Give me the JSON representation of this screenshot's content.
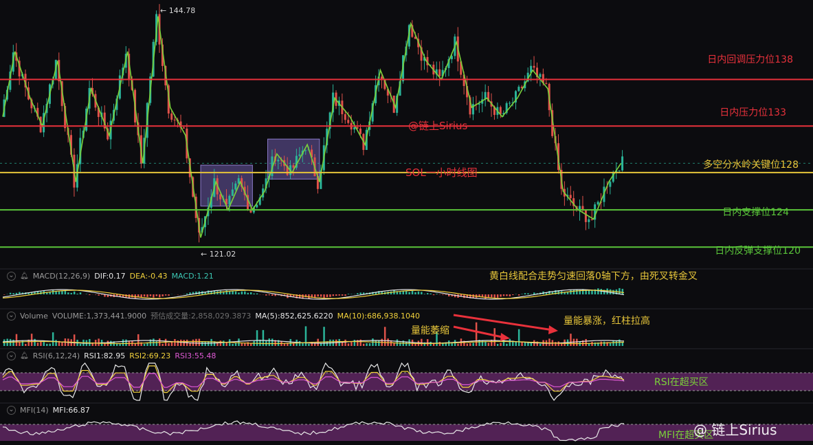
{
  "colors": {
    "background": "#0c0c0f",
    "up_candle": "#2bb59a",
    "down_candle": "#e0524a",
    "trend_line": "#7bd13a",
    "box_fill": "#6b5aa8",
    "resist_red": "#e8313b",
    "key_yellow": "#e6c53a",
    "support_green": "#5ac53a",
    "rsi_band": "#6a2a6e"
  },
  "main_chart": {
    "title_annotation": "SOL一小时线图",
    "watermark_center": "@链上Sirius",
    "high_marker": "← 144.78",
    "low_marker": "← 121.02",
    "levels": [
      {
        "label": "日内回调压力位138",
        "value": 138,
        "color": "#e8313b"
      },
      {
        "label": "日内压力位133",
        "value": 133,
        "color": "#e8313b"
      },
      {
        "label": "多空分水岭关键位128",
        "value": 128,
        "color": "#e6c53a"
      },
      {
        "label": "日内支撑位124",
        "value": 124,
        "color": "#5ac53a"
      },
      {
        "label": "日内反弹支撑位120",
        "value": 120,
        "color": "#5ac53a"
      }
    ]
  },
  "macd": {
    "name": "MACD(12,26,9)",
    "dif_label": "DIF:0.17",
    "dea_label": "DEA:-0.43",
    "macd_label": "MACD:1.21",
    "annotation": "黄白线配合走势匀速回落0轴下方，由死叉转金叉"
  },
  "volume": {
    "name": "Volume",
    "volume_label": "VOLUME:1,373,441.9000",
    "predicted_label": "预估成交量:2,858,029.3873",
    "ma5_label": "MA(5):852,625.6220",
    "ma10_label": "MA(10):686,938.1040",
    "annotation_shrink": "量能萎缩",
    "annotation_surge": "量能暴涨，红柱拉高"
  },
  "rsi": {
    "name": "RSI(6,12,24)",
    "rsi1_label": "RSI1:82.95",
    "rsi2_label": "RSI2:69.23",
    "rsi3_label": "RSI3:55.48",
    "annotation": "RSI在超买区"
  },
  "mfi": {
    "name": "MFI(14)",
    "mfi_label": "MFI:66.87",
    "annotation": "MFI在超买区"
  },
  "brand_watermark": "@ 链上Sirius",
  "chart_data": {
    "type": "candlestick",
    "title": "SOL一小时线图",
    "series_points": [
      {
        "i": 0,
        "p": 134
      },
      {
        "i": 4,
        "p": 141
      },
      {
        "i": 9,
        "p": 136
      },
      {
        "i": 13,
        "p": 133
      },
      {
        "i": 18,
        "p": 140
      },
      {
        "i": 24,
        "p": 127
      },
      {
        "i": 29,
        "p": 137
      },
      {
        "i": 35,
        "p": 132
      },
      {
        "i": 41,
        "p": 141
      },
      {
        "i": 46,
        "p": 129
      },
      {
        "i": 51,
        "p": 144.78
      },
      {
        "i": 55,
        "p": 135
      },
      {
        "i": 60,
        "p": 132
      },
      {
        "i": 65,
        "p": 121.02
      },
      {
        "i": 70,
        "p": 127
      },
      {
        "i": 74,
        "p": 124
      },
      {
        "i": 78,
        "p": 127
      },
      {
        "i": 82,
        "p": 124
      },
      {
        "i": 86,
        "p": 126
      },
      {
        "i": 90,
        "p": 130
      },
      {
        "i": 95,
        "p": 128
      },
      {
        "i": 100,
        "p": 131
      },
      {
        "i": 104,
        "p": 127
      },
      {
        "i": 109,
        "p": 136
      },
      {
        "i": 114,
        "p": 134
      },
      {
        "i": 119,
        "p": 131
      },
      {
        "i": 124,
        "p": 139
      },
      {
        "i": 129,
        "p": 135
      },
      {
        "i": 134,
        "p": 144
      },
      {
        "i": 139,
        "p": 140
      },
      {
        "i": 144,
        "p": 138
      },
      {
        "i": 149,
        "p": 142
      },
      {
        "i": 154,
        "p": 135
      },
      {
        "i": 159,
        "p": 136
      },
      {
        "i": 164,
        "p": 134
      },
      {
        "i": 169,
        "p": 136
      },
      {
        "i": 174,
        "p": 139
      },
      {
        "i": 179,
        "p": 137
      },
      {
        "i": 184,
        "p": 126
      },
      {
        "i": 189,
        "p": 124
      },
      {
        "i": 194,
        "p": 123
      },
      {
        "i": 199,
        "p": 127
      },
      {
        "i": 203,
        "p": 129
      }
    ],
    "boxes": [
      {
        "from": 65,
        "to": 82,
        "high": 128.8,
        "low": 124.4
      },
      {
        "from": 87,
        "to": 104,
        "high": 131.6,
        "low": 127.3
      }
    ],
    "levels": [
      138,
      133,
      128,
      124,
      120
    ],
    "high": 144.78,
    "low": 121.02,
    "ylim": [
      119.5,
      145.5
    ],
    "macd": {
      "dif": 0.17,
      "dea": -0.43,
      "macd": 1.21
    },
    "volume": {
      "volume": 1373441.9,
      "predicted": 2858029.3873,
      "ma5": 852625.622,
      "ma10": 686938.104
    },
    "rsi": {
      "rsi1": 82.95,
      "rsi2": 69.23,
      "rsi3": 55.48,
      "band": [
        70,
        80
      ]
    },
    "mfi": {
      "mfi": 66.87
    }
  }
}
